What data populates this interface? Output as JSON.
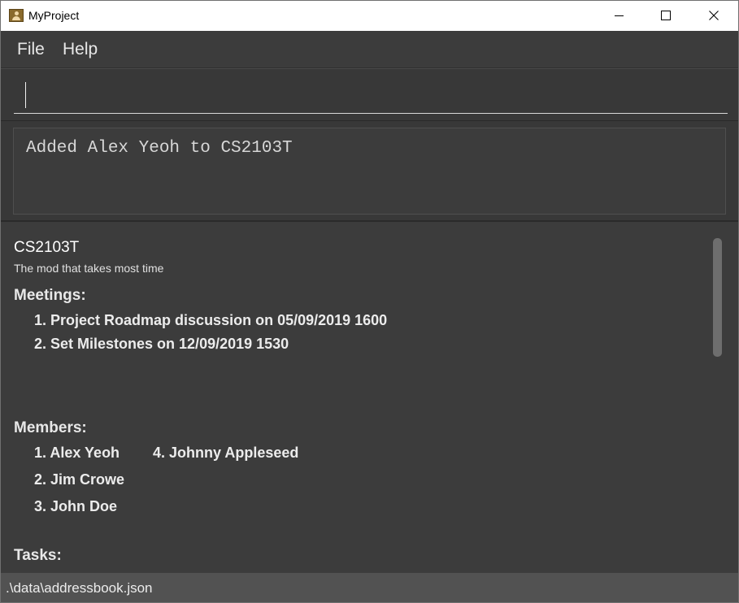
{
  "window": {
    "title": "MyProject"
  },
  "menu": {
    "file": "File",
    "help": "Help"
  },
  "command": {
    "value": ""
  },
  "result": {
    "message": "Added Alex Yeoh to CS2103T"
  },
  "project": {
    "name": "CS2103T",
    "description": "The mod that takes most time",
    "meetings_label": "Meetings:",
    "meetings": [
      "1. Project Roadmap discussion on 05/09/2019 1600",
      "2. Set Milestones on 12/09/2019 1530"
    ],
    "members_label": "Members:",
    "members": [
      "1. Alex Yeoh",
      "2. Jim Crowe",
      "3. John Doe",
      "4. Johnny Appleseed"
    ],
    "tasks_label": "Tasks:"
  },
  "status": {
    "path": ".\\data\\addressbook.json"
  },
  "colors": {
    "background": "#3c3c3c",
    "status_bar": "#525252",
    "text": "#ececec"
  },
  "icons": {
    "app": "address-book-icon",
    "minimize": "minimize-icon",
    "maximize": "maximize-icon",
    "close": "close-icon"
  }
}
